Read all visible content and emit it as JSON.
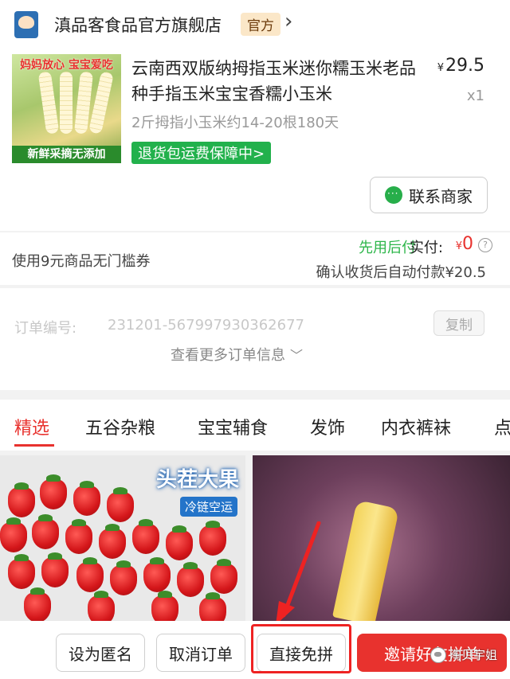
{
  "store": {
    "name": "滇品客食品官方旗舰店",
    "badge": "官方",
    "logo_icon": "store-logo-icon",
    "chevron_icon": "chevron-right-icon"
  },
  "product": {
    "image_banner": "妈妈放心 宝宝爱吃",
    "image_footer": "新鲜采摘无添加",
    "title": "云南西双版纳拇指玉米迷你糯玉米老品种手指玉米宝宝香糯小玉米",
    "currency": "¥",
    "price": "29.5",
    "quantity": "x1",
    "spec": "2斤拇指小玉米约14-20根180天",
    "guarantee": "退货包运费保障中>",
    "contact_button": "联系商家"
  },
  "payment": {
    "coupon": "使用9元商品无门槛券",
    "pay_later": "先用后付",
    "paid_label": "实付:",
    "currency": "¥",
    "paid_amount": "0",
    "info_icon": "?",
    "auto_pay": "确认收货后自动付款¥20.5"
  },
  "order": {
    "number_label": "订单编号:",
    "number": "231201-567997930362677",
    "copy_button": "复制",
    "more_info": "查看更多订单信息"
  },
  "tabs": [
    {
      "label": "精选",
      "active": true
    },
    {
      "label": "五谷杂粮",
      "active": false
    },
    {
      "label": "宝宝辅食",
      "active": false
    },
    {
      "label": "发饰",
      "active": false
    },
    {
      "label": "内衣裤袜",
      "active": false
    },
    {
      "label": "点",
      "active": false
    }
  ],
  "feed": {
    "left_tag": "头茬大果",
    "left_badge": "冷链空运"
  },
  "actions": {
    "anonymous": "设为匿名",
    "cancel": "取消订单",
    "direct": "直接免拼",
    "invite": "邀请好友拼单"
  },
  "watermark": "淘贝宇姐",
  "colors": {
    "accent_red": "#e8322e",
    "green": "#22b14c"
  }
}
